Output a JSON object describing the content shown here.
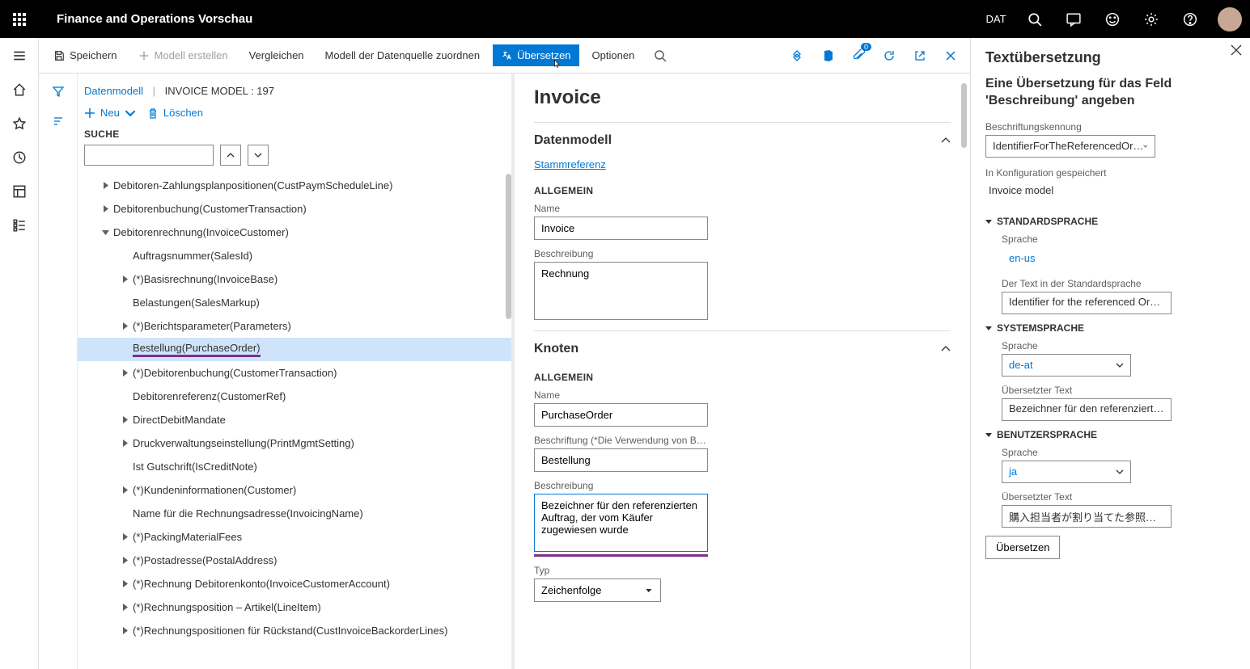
{
  "topbar": {
    "app_title": "Finance and Operations Vorschau",
    "company": "DAT"
  },
  "cmdbar": {
    "save": "Speichern",
    "create_model": "Modell erstellen",
    "compare": "Vergleichen",
    "map_datasource": "Modell der Datenquelle zuordnen",
    "translate": "Übersetzen",
    "options": "Optionen",
    "badge": "0"
  },
  "crumb": {
    "root": "Datenmodell",
    "current": "INVOICE MODEL : 197"
  },
  "tree_actions": {
    "new": "Neu",
    "delete": "Löschen"
  },
  "search_label": "SUCHE",
  "tree": [
    {
      "lvl": 1,
      "chev": "r",
      "lbl": "Debitoren-Zahlungsplanpositionen(CustPaymScheduleLine)"
    },
    {
      "lvl": 1,
      "chev": "r",
      "lbl": "Debitorenbuchung(CustomerTransaction)"
    },
    {
      "lvl": 1,
      "chev": "d",
      "lbl": "Debitorenrechnung(InvoiceCustomer)"
    },
    {
      "lvl": 2,
      "chev": "",
      "lbl": "Auftragsnummer(SalesId)"
    },
    {
      "lvl": 2,
      "chev": "r",
      "lbl": "(*)Basisrechnung(InvoiceBase)"
    },
    {
      "lvl": 2,
      "chev": "",
      "lbl": "Belastungen(SalesMarkup)"
    },
    {
      "lvl": 2,
      "chev": "r",
      "lbl": "(*)Berichtsparameter(Parameters)"
    },
    {
      "lvl": 2,
      "chev": "",
      "lbl": "Bestellung(PurchaseOrder)",
      "sel": true,
      "ul": true
    },
    {
      "lvl": 2,
      "chev": "r",
      "lbl": "(*)Debitorenbuchung(CustomerTransaction)"
    },
    {
      "lvl": 2,
      "chev": "",
      "lbl": "Debitorenreferenz(CustomerRef)"
    },
    {
      "lvl": 2,
      "chev": "r",
      "lbl": "DirectDebitMandate"
    },
    {
      "lvl": 2,
      "chev": "r",
      "lbl": "Druckverwaltungseinstellung(PrintMgmtSetting)"
    },
    {
      "lvl": 2,
      "chev": "",
      "lbl": "Ist Gutschrift(IsCreditNote)"
    },
    {
      "lvl": 2,
      "chev": "r",
      "lbl": "(*)Kundeninformationen(Customer)"
    },
    {
      "lvl": 2,
      "chev": "",
      "lbl": "Name für die Rechnungsadresse(InvoicingName)"
    },
    {
      "lvl": 2,
      "chev": "r",
      "lbl": "(*)PackingMaterialFees"
    },
    {
      "lvl": 2,
      "chev": "r",
      "lbl": "(*)Postadresse(PostalAddress)"
    },
    {
      "lvl": 2,
      "chev": "r",
      "lbl": "(*)Rechnung Debitorenkonto(InvoiceCustomerAccount)"
    },
    {
      "lvl": 2,
      "chev": "r",
      "lbl": "(*)Rechnungsposition – Artikel(LineItem)"
    },
    {
      "lvl": 2,
      "chev": "r",
      "lbl": "(*)Rechnungspositionen für Rückstand(CustInvoiceBackorderLines)"
    }
  ],
  "detail": {
    "title": "Invoice",
    "dm_header": "Datenmodell",
    "dm_link": "Stammreferenz",
    "general": "ALLGEMEIN",
    "name_lbl": "Name",
    "name_val": "Invoice",
    "desc_lbl": "Beschreibung",
    "desc_val": "Rechnung",
    "node_header": "Knoten",
    "n_name_lbl": "Name",
    "n_name_val": "PurchaseOrder",
    "n_caption_lbl": "Beschriftung (*Die Verwendung von B…",
    "n_caption_val": "Bestellung",
    "n_desc_lbl": "Beschreibung",
    "n_desc_val": "Bezeichner für den referenzierten Auftrag, der vom Käufer zugewiesen wurde",
    "n_type_lbl": "Typ",
    "n_type_val": "Zeichenfolge"
  },
  "trans": {
    "title": "Textübersetzung",
    "subtitle": "Eine Übersetzung für das Feld 'Beschreibung' angeben",
    "label_id_lbl": "Beschriftungskennung",
    "label_id_val": "IdentifierForTheReferencedOr…",
    "stored_lbl": "In Konfiguration gespeichert",
    "stored_val": "Invoice model",
    "std_lang_hdr": "STANDARDSPRACHE",
    "lang_lbl": "Sprache",
    "std_lang_val": "en-us",
    "std_text_lbl": "Der Text in der Standardsprache",
    "std_text_val": "Identifier for the referenced Or…",
    "sys_lang_hdr": "SYSTEMSPRACHE",
    "sys_lang_val": "de-at",
    "trans_text_lbl": "Übersetzter Text",
    "sys_text_val": "Bezeichner für den referenzierte…",
    "user_lang_hdr": "BENUTZERSPRACHE",
    "user_lang_val": "ja",
    "user_text_val": "購入担当者が割り当てた参照オ…",
    "btn": "Übersetzen"
  }
}
